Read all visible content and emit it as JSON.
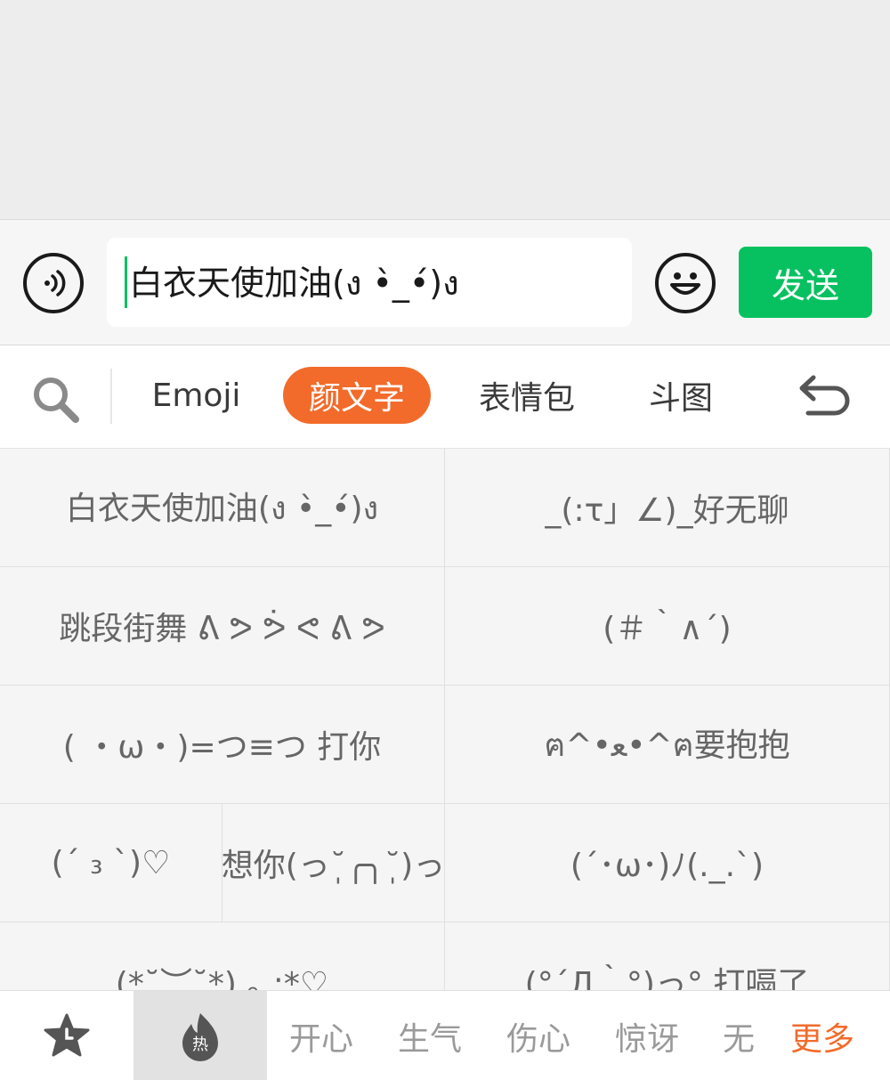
{
  "input": {
    "value": "白衣天使加油(ง •̀_•́)ง",
    "send_label": "发送"
  },
  "tabs": [
    {
      "label": "Emoji",
      "active": false
    },
    {
      "label": "颜文字",
      "active": true
    },
    {
      "label": "表情包",
      "active": false
    },
    {
      "label": "斗图",
      "active": false
    }
  ],
  "icons": {
    "voice": "voice-icon",
    "emoji": "smiley-icon",
    "search": "search-icon",
    "back": "undo-icon",
    "favorites": "star-clock-icon",
    "hot": "flame-icon"
  },
  "kaomoji": [
    "白衣天使加油(ง •̀_•́)ง",
    "_(:τ」∠)_好无聊",
    "跳段街舞 ᕕ ᕗ ᕘ ᕙ ᕕ ᕗ",
    "(＃｀∧´)",
    "( ・ω・)=つ≡つ 打你",
    "ฅ^•ﻌ•^ฅ要抱抱",
    "(ˊ ₃ ˋ)♡",
    "想你(っ˘̩╭╮˘̩)っ",
    "(´･ω･)ﾉ(._.`)",
    "(*˘︶˘*).｡.:*♡",
    "(°´Д｀°)っ° 打嗝了"
  ],
  "bottom": {
    "hot_label": "热",
    "categories": [
      "开心",
      "生气",
      "伤心",
      "惊讶",
      "无"
    ],
    "more_label": "更多"
  },
  "colors": {
    "accent_orange": "#f26b2a",
    "send_green": "#07c160"
  }
}
